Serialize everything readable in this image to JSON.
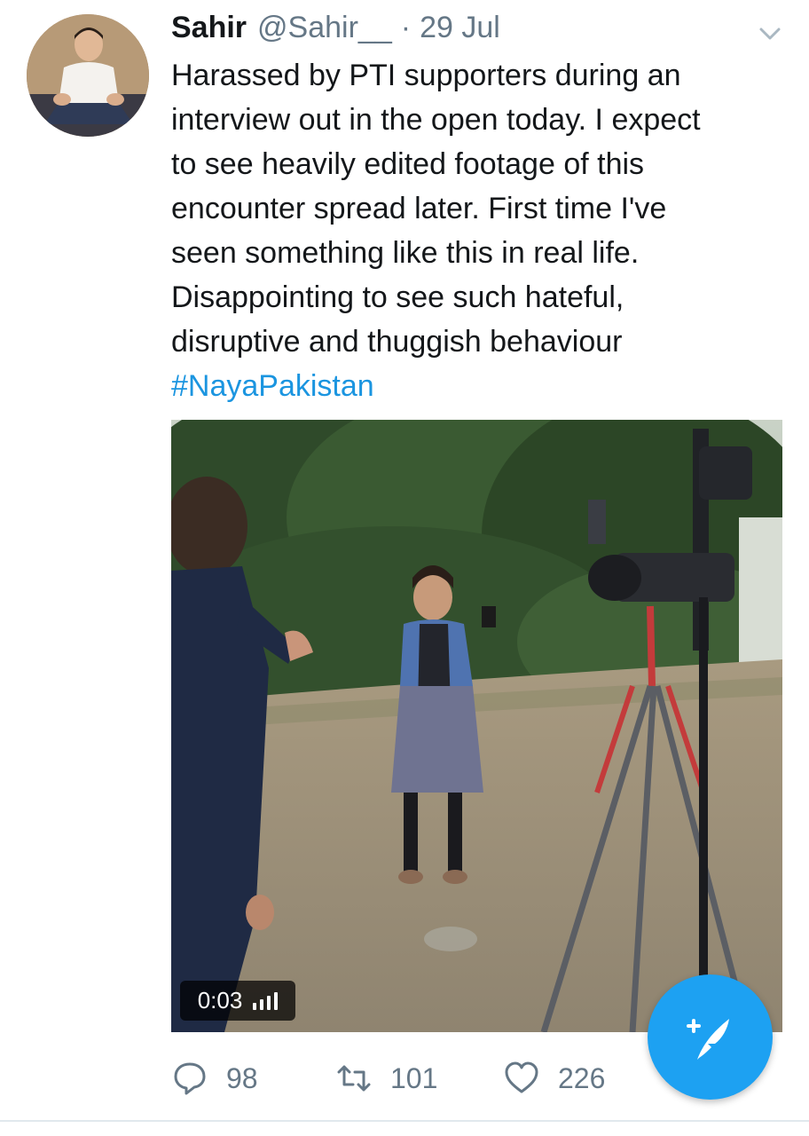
{
  "tweet": {
    "author_name": "Sahir",
    "author_handle": "@Sahir__",
    "separator": "·",
    "timestamp": "29 Jul",
    "text_lines": [
      "Harassed by PTI supporters during an",
      "interview out in the open today. I expect",
      "to see heavily edited footage of this",
      "encounter spread later. First time I've",
      "seen something like this in real life.",
      "Disappointing to see such hateful,",
      "disruptive and thuggish behaviour"
    ],
    "hashtag": "#NayaPakistan"
  },
  "media": {
    "type": "video",
    "duration": "0:03",
    "sound_icon": "volume-bars-icon"
  },
  "actions": {
    "replies": "98",
    "retweets": "101",
    "likes": "226"
  },
  "icons": {
    "caret": "chevron-down-icon",
    "reply": "reply-icon",
    "retweet": "retweet-icon",
    "like": "heart-icon",
    "compose": "compose-tweet-icon"
  },
  "colors": {
    "link": "#1b95e0",
    "secondary_text": "#657786",
    "fab": "#1da1f2"
  }
}
